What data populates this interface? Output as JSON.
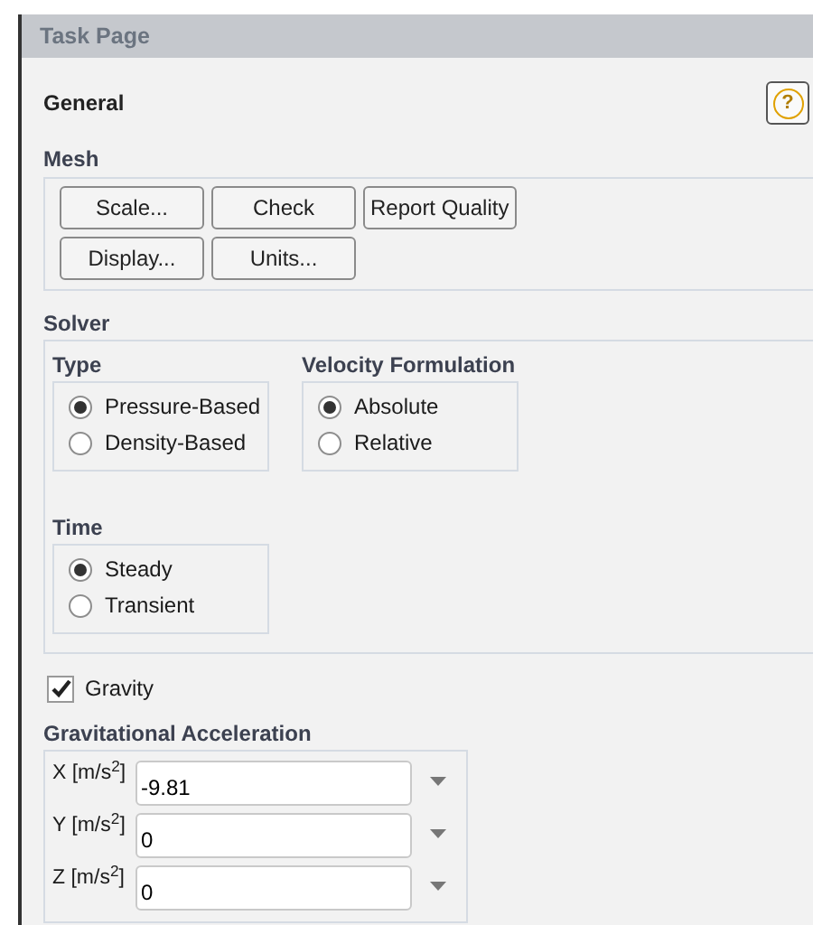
{
  "window": {
    "title": "Task Page"
  },
  "page": {
    "heading": "General",
    "help_button": "?"
  },
  "mesh": {
    "title": "Mesh",
    "button_rows": [
      {
        "buttons": [
          "Scale...",
          "Check",
          "Report Quality"
        ]
      },
      {
        "buttons": [
          "Display...",
          "Units..."
        ]
      }
    ]
  },
  "solver": {
    "title": "Solver",
    "groups": [
      {
        "title": "Type",
        "options": [
          {
            "label": "Pressure-Based",
            "selected": true
          },
          {
            "label": "Density-Based",
            "selected": false
          }
        ]
      },
      {
        "title": "Velocity Formulation",
        "options": [
          {
            "label": "Absolute",
            "selected": true
          },
          {
            "label": "Relative",
            "selected": false
          }
        ]
      },
      {
        "title": "Time",
        "options": [
          {
            "label": "Steady",
            "selected": true
          },
          {
            "label": "Transient",
            "selected": false
          }
        ]
      }
    ]
  },
  "gravity": {
    "label": "Gravity",
    "checked": true
  },
  "acceleration": {
    "title": "Gravitational Acceleration",
    "components": [
      {
        "label": "X [m/s$^{2}$]",
        "value": "-9.81"
      },
      {
        "label": "Y [m/s$^{2}$]",
        "value": "0"
      },
      {
        "label": "Z [m/s$^{2}$]",
        "value": "0"
      }
    ]
  }
}
